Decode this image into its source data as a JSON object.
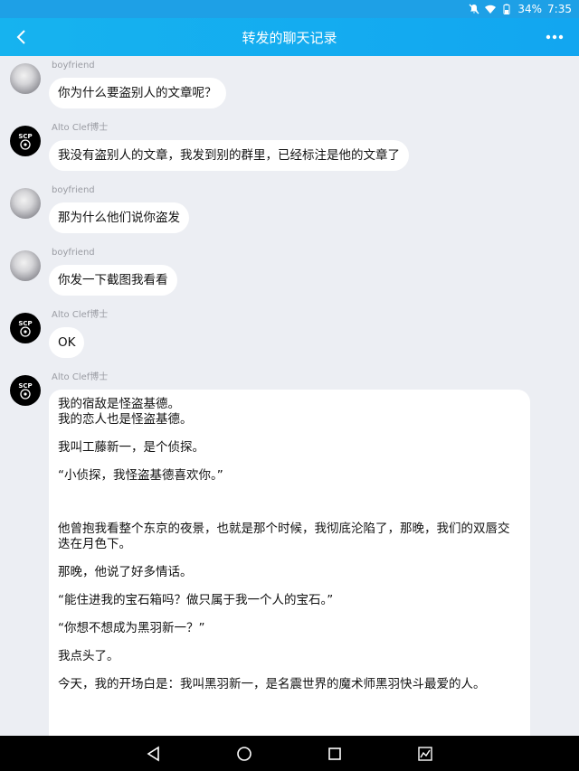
{
  "status_bar": {
    "battery": "34%",
    "time": "7:35"
  },
  "header": {
    "title": "转发的聊天记录"
  },
  "messages": [
    {
      "sender": "boyfriend",
      "text": "你为什么要盗别人的文章呢？"
    },
    {
      "sender": "Alto Clef博士",
      "text": "我没有盗别人的文章，我发到别的群里，已经标注是他的文章了"
    },
    {
      "sender": "boyfriend",
      "text": "那为什么他们说你盗发"
    },
    {
      "sender": "boyfriend",
      "text": "你发一下截图我看看"
    },
    {
      "sender": "Alto Clef博士",
      "text": "OK"
    },
    {
      "sender": "Alto Clef博士",
      "paragraphs": [
        "我的宿敌是怪盗基德。",
        "我的恋人也是怪盗基德。",
        "",
        "我叫工藤新一，是个侦探。",
        "",
        "“小侦探，我怪盗基德喜欢你。”",
        "",
        "",
        "他曾抱我看整个东京的夜景，也就是那个时候，我彻底沦陷了，那晚，我们的双唇交迭在月色下。",
        "",
        "那晚，他说了好多情话。",
        "",
        "“能住进我的宝石箱吗？做只属于我一个人的宝石。”",
        "",
        "“你想不想成为黑羽新一？”",
        "",
        "我点头了。",
        "",
        "今天，我的开场白是：我叫黑羽新一，是名震世界的魔术师黑羽快斗最爱的人。"
      ]
    }
  ]
}
